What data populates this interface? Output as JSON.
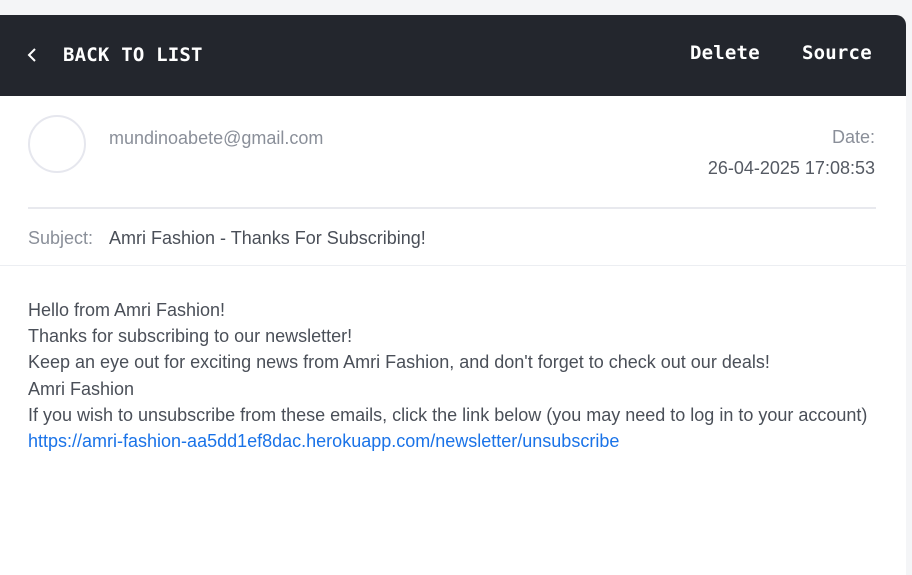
{
  "toolbar": {
    "back_label": "BACK TO LIST",
    "back_icon": "chevron-left-icon",
    "delete_label": "Delete",
    "source_label": "Source"
  },
  "email": {
    "from": "mundinoabete@gmail.com",
    "date_label": "Date:",
    "date_value": "26-04-2025 17:08:53",
    "subject_label": "Subject:",
    "subject_value": "Amri Fashion - Thanks For Subscribing!",
    "body_lines": [
      "Hello from Amri Fashion!",
      "Thanks for subscribing to our newsletter!",
      "Keep an eye out for exciting news from Amri Fashion, and don't forget to check out our deals!",
      "Amri Fashion",
      "If you wish to unsubscribe from these emails, click the link below (you may need to log in to your account)"
    ],
    "unsubscribe_link": "https://amri-fashion-aa5dd1ef8dac.herokuapp.com/newsletter/unsubscribe"
  },
  "colors": {
    "toolbar_bg": "#23262d",
    "link": "#1a73e8",
    "muted_text": "#8a8f99",
    "body_text": "#4a4f58"
  }
}
